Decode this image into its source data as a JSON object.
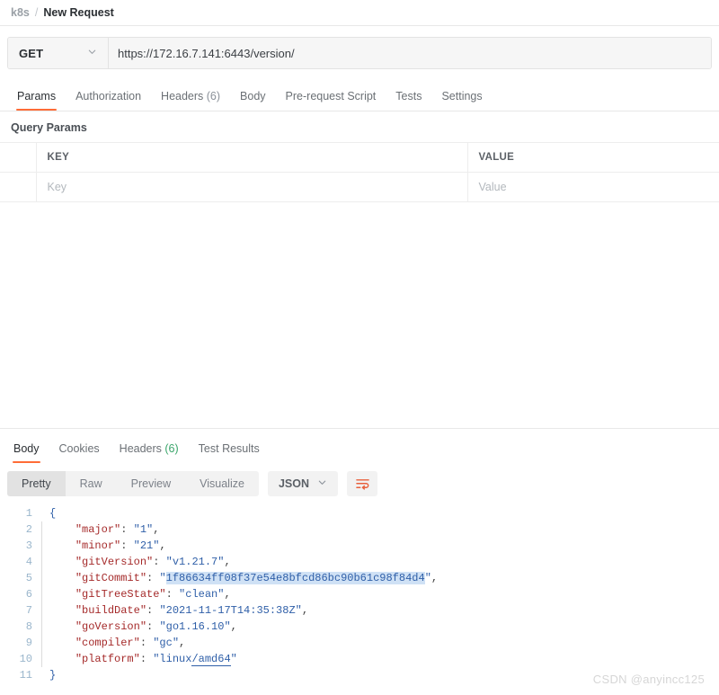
{
  "breadcrumb": {
    "collection": "k8s",
    "separator": "/",
    "request_name": "New Request"
  },
  "request_bar": {
    "method": "GET",
    "method_chevron": "chevron-down-icon",
    "url": "https://172.16.7.141:6443/version/"
  },
  "request_tabs": [
    {
      "label": "Params",
      "count": "",
      "active": true
    },
    {
      "label": "Authorization",
      "count": "",
      "active": false
    },
    {
      "label": "Headers",
      "count": "(6)",
      "active": false
    },
    {
      "label": "Body",
      "count": "",
      "active": false
    },
    {
      "label": "Pre-request Script",
      "count": "",
      "active": false
    },
    {
      "label": "Tests",
      "count": "",
      "active": false
    },
    {
      "label": "Settings",
      "count": "",
      "active": false
    }
  ],
  "query_params": {
    "section_label": "Query Params",
    "headers": {
      "key": "KEY",
      "value": "VALUE"
    },
    "rows": [
      {
        "key_placeholder": "Key",
        "value_placeholder": "Value"
      }
    ]
  },
  "response_tabs": [
    {
      "label": "Body",
      "count": "",
      "active": true
    },
    {
      "label": "Cookies",
      "count": "",
      "active": false
    },
    {
      "label": "Headers",
      "count": "(6)",
      "active": false
    },
    {
      "label": "Test Results",
      "count": "",
      "active": false
    }
  ],
  "response_toolbar": {
    "view_modes": [
      {
        "label": "Pretty",
        "active": true
      },
      {
        "label": "Raw",
        "active": false
      },
      {
        "label": "Preview",
        "active": false
      },
      {
        "label": "Visualize",
        "active": false
      }
    ],
    "format": "JSON",
    "format_chevron": "chevron-down-icon",
    "wrap_icon": "wrap-text-icon"
  },
  "response_body": {
    "language": "json",
    "lines": [
      {
        "n": "1",
        "text": "{"
      },
      {
        "n": "2",
        "text": "    \"major\": \"1\","
      },
      {
        "n": "3",
        "text": "    \"minor\": \"21\","
      },
      {
        "n": "4",
        "text": "    \"gitVersion\": \"v1.21.7\","
      },
      {
        "n": "5",
        "text": "    \"gitCommit\": \"1f86634ff08f37e54e8bfcd86bc90b61c98f84d4\","
      },
      {
        "n": "6",
        "text": "    \"gitTreeState\": \"clean\","
      },
      {
        "n": "7",
        "text": "    \"buildDate\": \"2021-11-17T14:35:38Z\","
      },
      {
        "n": "8",
        "text": "    \"goVersion\": \"go1.16.10\","
      },
      {
        "n": "9",
        "text": "    \"compiler\": \"gc\","
      },
      {
        "n": "10",
        "text": "    \"platform\": \"linux/amd64\""
      },
      {
        "n": "11",
        "text": "}"
      }
    ],
    "parsed": {
      "major": "1",
      "minor": "21",
      "gitVersion": "v1.21.7",
      "gitCommit": "1f86634ff08f37e54e8bfcd86bc90b61c98f84d4",
      "gitTreeState": "clean",
      "buildDate": "2021-11-17T14:35:38Z",
      "goVersion": "go1.16.10",
      "compiler": "gc",
      "platform": "linux/amd64"
    },
    "selected_text": "1f86634ff08f37e54e8bfcd86bc90b61c98f84d4"
  },
  "watermark": "CSDN @anyincc125",
  "colors": {
    "accent": "#ff6c37",
    "json_key": "#a52a2a",
    "json_value": "#2f5fa8",
    "gutter": "#9ab6cc",
    "selection": "#cfe1f5",
    "count_green": "#3aa56a"
  }
}
